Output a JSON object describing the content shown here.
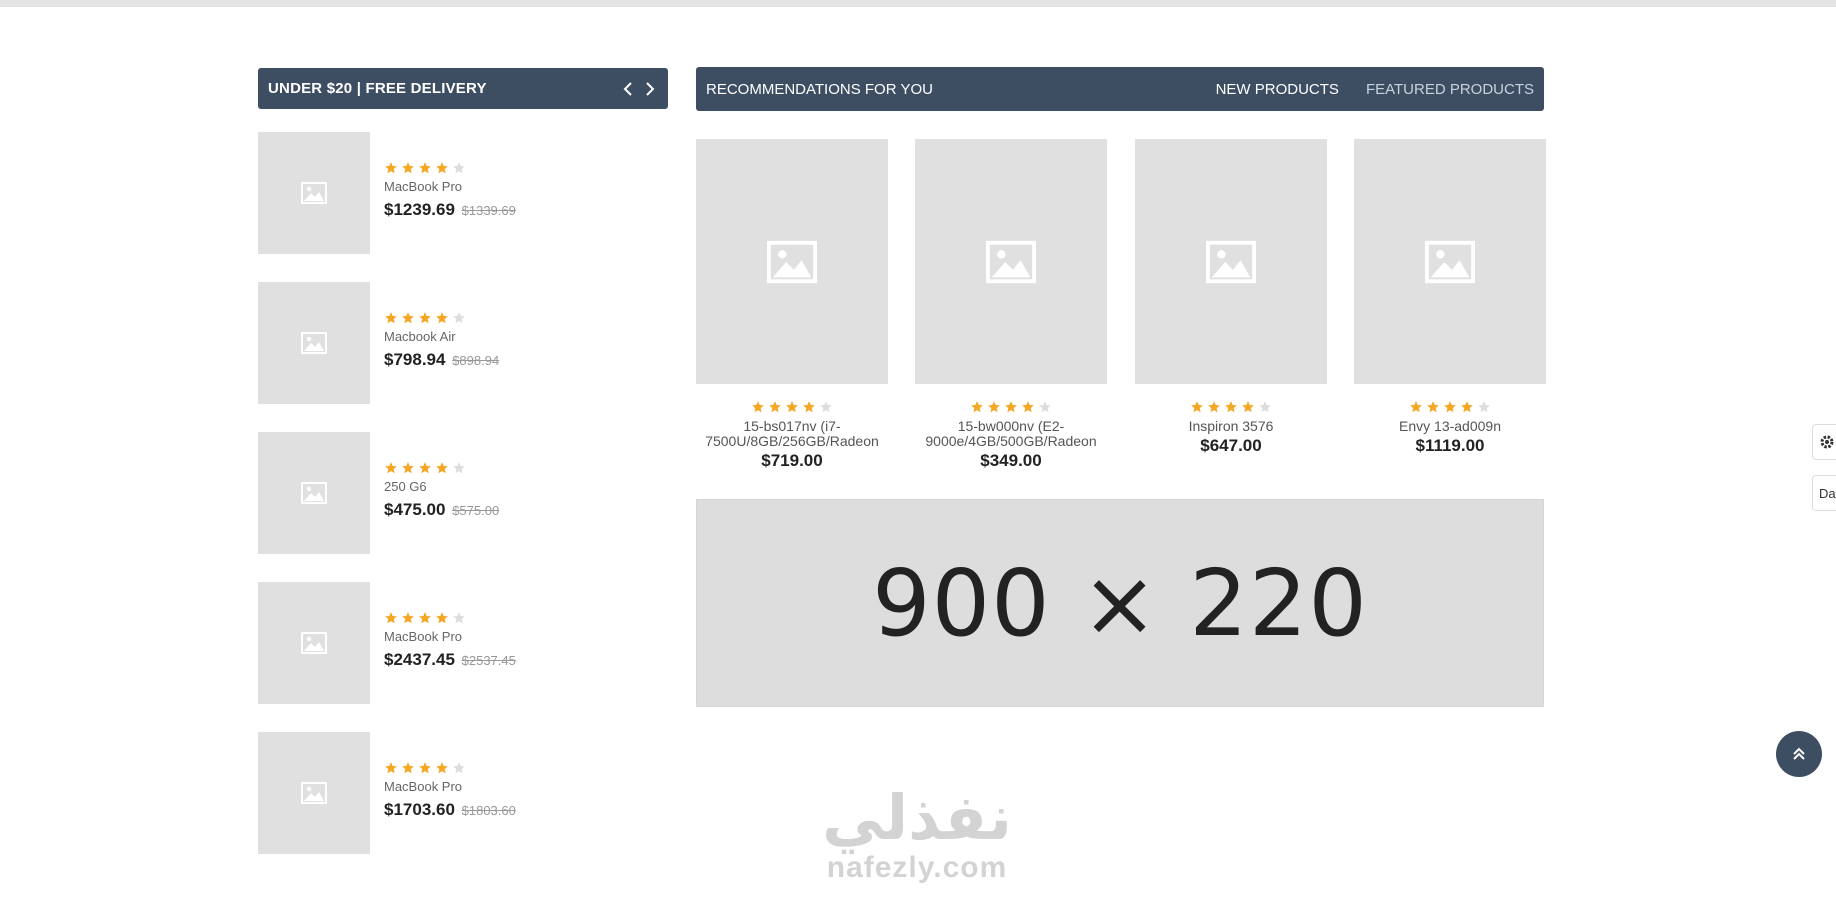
{
  "deals": {
    "title": "UNDER $20 | FREE DELIVERY",
    "items": [
      {
        "name": "MacBook Pro",
        "price": "$1239.69",
        "old_price": "$1339.69",
        "rating": 4
      },
      {
        "name": "Macbook Air",
        "price": "$798.94",
        "old_price": "$898.94",
        "rating": 4
      },
      {
        "name": "250 G6",
        "price": "$475.00",
        "old_price": "$575.00",
        "rating": 4
      },
      {
        "name": "MacBook Pro",
        "price": "$2437.45",
        "old_price": "$2537.45",
        "rating": 4
      },
      {
        "name": "MacBook Pro",
        "price": "$1703.60",
        "old_price": "$1803.60",
        "rating": 4
      }
    ]
  },
  "recommendations": {
    "title": "RECOMMENDATIONS FOR YOU",
    "tabs": [
      {
        "label": "NEW PRODUCTS",
        "active": true
      },
      {
        "label": "FEATURED PRODUCTS",
        "active": false
      }
    ],
    "products": [
      {
        "name": "15-bs017nv (i7-7500U/8GB/256GB/Radeon",
        "price": "$719.00",
        "rating": 4
      },
      {
        "name": "15-bw000nv (E2-9000e/4GB/500GB/Radeon",
        "price": "$349.00",
        "rating": 4
      },
      {
        "name": "Inspiron 3576",
        "price": "$647.00",
        "rating": 4
      },
      {
        "name": "Envy 13-ad009n",
        "price": "$1119.00",
        "rating": 4
      }
    ]
  },
  "banner": {
    "text": "900 × 220"
  },
  "side_widget": {
    "dark_label": "Da"
  },
  "watermark": {
    "arabic": "نفذلي",
    "latin": "nafezly.com"
  },
  "colors": {
    "header_bg": "#3d4e63",
    "star_on": "#f5a623",
    "star_off": "#dddddd",
    "placeholder_bg": "#e0e0e0"
  },
  "icons": {
    "prev": "chevron-left-icon",
    "next": "chevron-right-icon",
    "image": "image-placeholder-icon",
    "star": "star-icon",
    "gear": "gear-icon",
    "scroll_top": "double-chevron-up-icon"
  }
}
